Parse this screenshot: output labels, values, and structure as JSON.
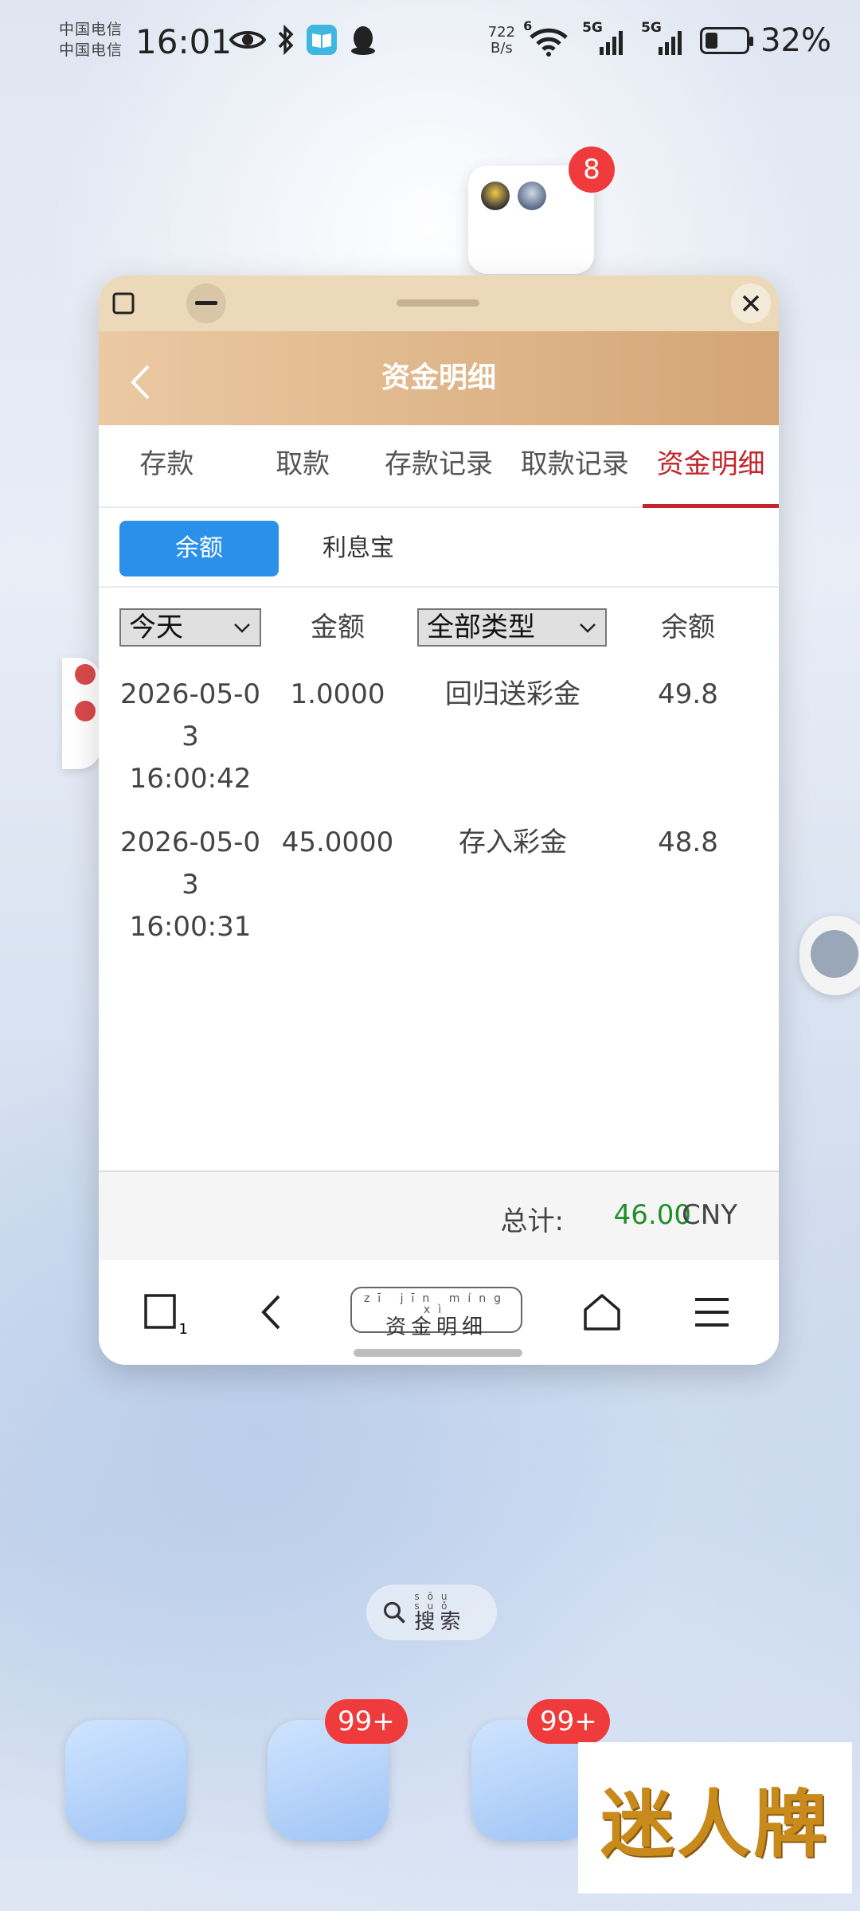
{
  "status_bar": {
    "carrier_line1": "中国电信",
    "carrier_line2": "中国电信",
    "time": "16:01",
    "net_speed_value": "722",
    "net_speed_unit": "B/s",
    "wifi_badge": "6",
    "sim1_label": "5G",
    "sim2_label": "5G",
    "battery_percent": "32%",
    "battery_level": 0.32
  },
  "floating_bubble": {
    "badge": "8"
  },
  "window": {
    "header_title": "资金明细",
    "tabs": [
      {
        "label": "存款",
        "active": false
      },
      {
        "label": "取款",
        "active": false
      },
      {
        "label": "存款记录",
        "active": false
      },
      {
        "label": "取款记录",
        "active": false
      },
      {
        "label": "资金明细",
        "active": true
      }
    ],
    "subtabs": [
      {
        "label": "余额",
        "active": true
      },
      {
        "label": "利息宝",
        "active": false
      }
    ],
    "table": {
      "date_filter": "今天",
      "amount_header": "金额",
      "type_filter": "全部类型",
      "balance_header": "余额",
      "rows": [
        {
          "date": "2026-05-03",
          "time": "16:00:42",
          "amount": "1.0000",
          "type": "回归送彩金",
          "balance": "49.8"
        },
        {
          "date": "2026-05-03",
          "time": "16:00:31",
          "amount": "45.0000",
          "type": "存入彩金",
          "balance": "48.8"
        }
      ]
    },
    "total": {
      "label": "总计:",
      "value": "46.00",
      "unit": "CNY"
    },
    "browser": {
      "tab_count": "1",
      "page_pinyin": "zī jīn míng xì",
      "page_title": "资金明细"
    }
  },
  "home": {
    "search_pinyin": "sōu suǒ",
    "search_label": "搜索",
    "dock_badges": [
      "99+",
      "99+"
    ],
    "watermark": "迷人牌"
  }
}
